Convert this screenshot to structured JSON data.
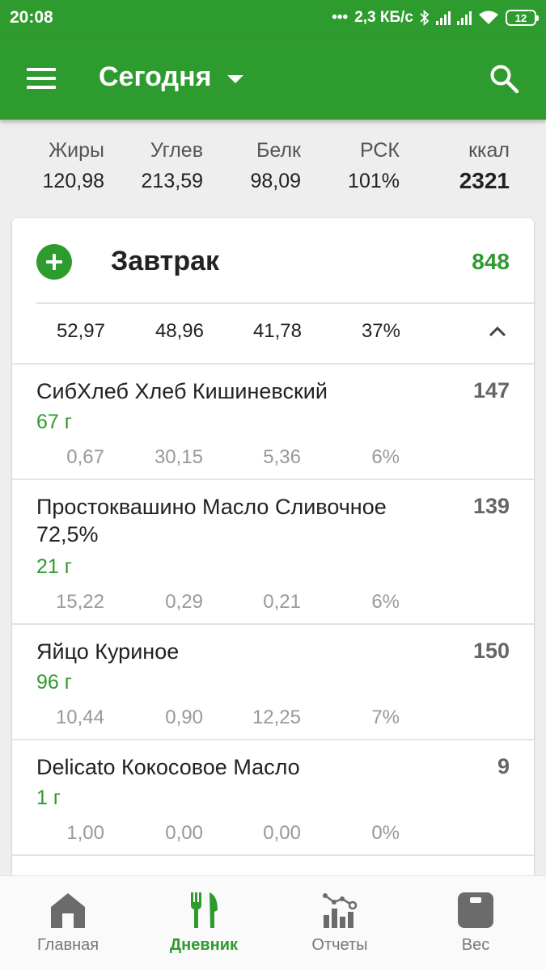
{
  "status_bar": {
    "time": "20:08",
    "speed": "2,3 КБ/с",
    "battery": "12"
  },
  "app_bar": {
    "title": "Сегодня",
    "menu_icon": "menu-icon",
    "search_icon": "search-icon"
  },
  "totals": {
    "labels": [
      "Жиры",
      "Углев",
      "Белк",
      "РСК",
      "ккал"
    ],
    "values": [
      "120,98",
      "213,59",
      "98,09",
      "101%",
      "2321"
    ]
  },
  "meal": {
    "title": "Завтрак",
    "kcal": "848",
    "totals": [
      "52,97",
      "48,96",
      "41,78",
      "37%"
    ],
    "items": [
      {
        "name": "СибХлеб Хлеб Кишиневский",
        "kcal": "147",
        "weight": "67 г",
        "nutrients": [
          "0,67",
          "30,15",
          "5,36",
          "6%"
        ]
      },
      {
        "name": "Простоквашино Масло Сливочное 72,5%",
        "kcal": "139",
        "weight": "21 г",
        "nutrients": [
          "15,22",
          "0,29",
          "0,21",
          "6%"
        ]
      },
      {
        "name": "Яйцо Куриное",
        "kcal": "150",
        "weight": "96 г",
        "nutrients": [
          "10,44",
          "0,90",
          "12,25",
          "7%"
        ]
      },
      {
        "name": "Delicato Кокосовое Масло",
        "kcal": "9",
        "weight": "1 г",
        "nutrients": [
          "1,00",
          "0,00",
          "0,00",
          "0%"
        ]
      }
    ]
  },
  "bottom_nav": [
    {
      "label": "Главная",
      "icon": "home-icon",
      "active": false
    },
    {
      "label": "Дневник",
      "icon": "fork-knife-icon",
      "active": true
    },
    {
      "label": "Отчеты",
      "icon": "reports-chart-icon",
      "active": false
    },
    {
      "label": "Вес",
      "icon": "scale-icon",
      "active": false
    }
  ],
  "colors": {
    "primary": "#2e9b2e",
    "background": "#eeeeee",
    "card": "#ffffff",
    "muted_text": "#999999"
  }
}
